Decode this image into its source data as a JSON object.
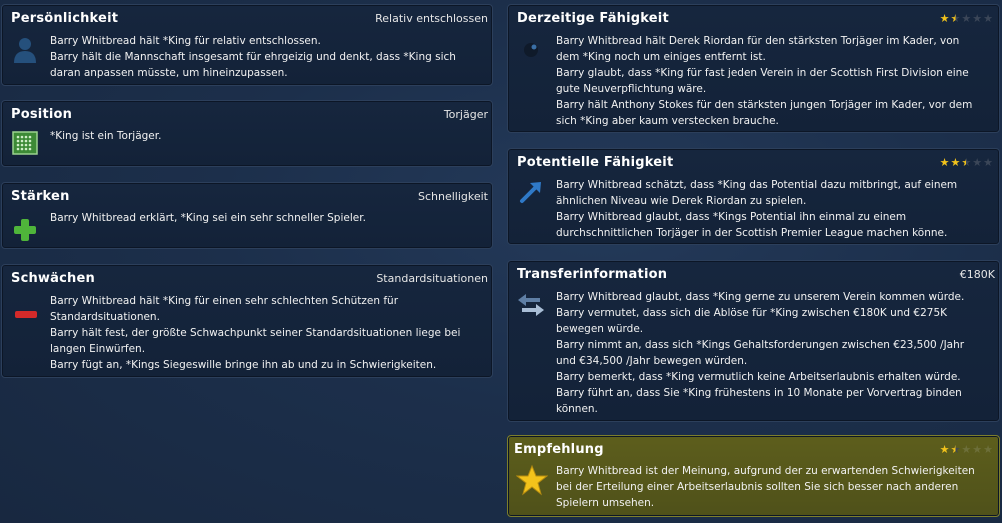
{
  "personality": {
    "title": "Persönlichkeit",
    "value": "Relativ entschlossen",
    "lines": [
      "Barry Whitbread hält *King für relativ entschlossen.",
      "Barry hält die Mannschaft insgesamt für ehrgeizig und denkt, dass *King sich",
      "daran anpassen müsste, um hineinzupassen."
    ],
    "icon": "person-icon"
  },
  "position": {
    "title": "Position",
    "value": "Torjäger",
    "lines": [
      "*King ist ein Torjäger."
    ],
    "icon": "pitch-icon"
  },
  "strengths": {
    "title": "Stärken",
    "value": "Schnelligkeit",
    "lines": [
      "Barry Whitbread erklärt, *King sei ein sehr schneller Spieler."
    ],
    "icon": "plus-icon"
  },
  "weaknesses": {
    "title": "Schwächen",
    "value": "Standardsituationen",
    "lines": [
      "Barry Whitbread hält *King für einen sehr schlechten Schützen für",
      "Standardsituationen.",
      "Barry hält fest, der größte Schwachpunkt seiner Standardsituationen liege bei",
      "langen Einwürfen.",
      "Barry fügt an, *Kings Siegeswille bringe ihn ab und zu in Schwierigkeiten."
    ],
    "icon": "minus-icon"
  },
  "current_ability": {
    "title": "Derzeitige Fähigkeit",
    "rating": 1.5,
    "rating_max": 5,
    "lines": [
      "Barry Whitbread hält Derek Riordan für den stärksten Torjäger im Kader, von",
      "dem *King noch um einiges entfernt ist.",
      "Barry glaubt, dass *King für fast jeden Verein in der Scottish First Division eine",
      "gute Neuverpflichtung wäre.",
      "Barry hält Anthony Stokes für den stärksten jungen Torjäger im Kader, vor dem",
      "sich *King aber kaum verstecken brauche."
    ],
    "icon": "ball-icon"
  },
  "potential_ability": {
    "title": "Potentielle Fähigkeit",
    "rating": 2.5,
    "rating_max": 5,
    "lines": [
      "Barry Whitbread schätzt, dass *King das Potential dazu mitbringt, auf einem",
      "ähnlichen Niveau wie Derek Riordan zu spielen.",
      "Barry Whitbread glaubt, dass *Kings Potential ihn einmal zu einem",
      "durchschnittlichen Torjäger in der Scottish Premier League machen könne."
    ],
    "icon": "arrow-up-icon"
  },
  "transfer": {
    "title": "Transferinformation",
    "value": "€180K",
    "lines": [
      "Barry Whitbread glaubt, dass *King gerne zu unserem Verein kommen würde.",
      "Barry vermutet, dass sich die Ablöse für *King zwischen €180K und €275K",
      "bewegen würde.",
      "Barry nimmt an, dass sich *Kings Gehaltsforderungen zwischen €23,500 /Jahr",
      "und €34,500 /Jahr bewegen würden.",
      "Barry bemerkt, dass *King vermutlich keine Arbeitserlaubnis erhalten würde.",
      "Barry führt an, dass Sie *King frühestens in 10 Monate per Vorvertrag binden",
      "können."
    ],
    "icon": "transfer-arrows-icon"
  },
  "recommendation": {
    "title": "Empfehlung",
    "rating": 1.5,
    "rating_max": 5,
    "lines": [
      "Barry Whitbread ist der Meinung, aufgrund der zu erwartenden Schwierigkeiten",
      "bei der Erteilung einer Arbeitserlaubnis sollten Sie sich besser nach anderen",
      "Spielern umsehen."
    ],
    "icon": "star-icon"
  },
  "colors": {
    "star": "#f3c31b",
    "star_empty": "#3b4658",
    "recommendation_bg": "#575918"
  }
}
